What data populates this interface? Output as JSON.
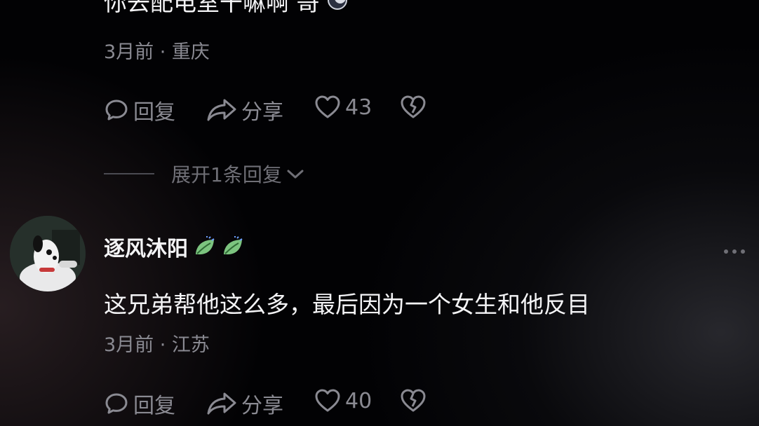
{
  "comment_top": {
    "text": "你去配电室干嘛啊 哥",
    "meta": "3月前 · 重庆",
    "reply_label": "回复",
    "share_label": "分享",
    "likes": "43"
  },
  "expand_replies": {
    "label": "展开1条回复"
  },
  "comment_main": {
    "username": "逐风沐阳",
    "text": "这兄弟帮他这么多，最后因为一个女生和他反目",
    "meta": "3月前 · 江苏",
    "reply_label": "回复",
    "share_label": "分享",
    "likes": "40"
  },
  "colors": {
    "background": "#020204",
    "primary_text": "#f4f4f6",
    "secondary_text": "#8a8a92",
    "leaf_green": "#6fbf73"
  },
  "icons": [
    "reply-icon",
    "share-icon",
    "heart-icon",
    "dislike-icon",
    "leaf-badge-icon",
    "more-icon",
    "chevron-down-icon",
    "moon-emoji-icon"
  ]
}
